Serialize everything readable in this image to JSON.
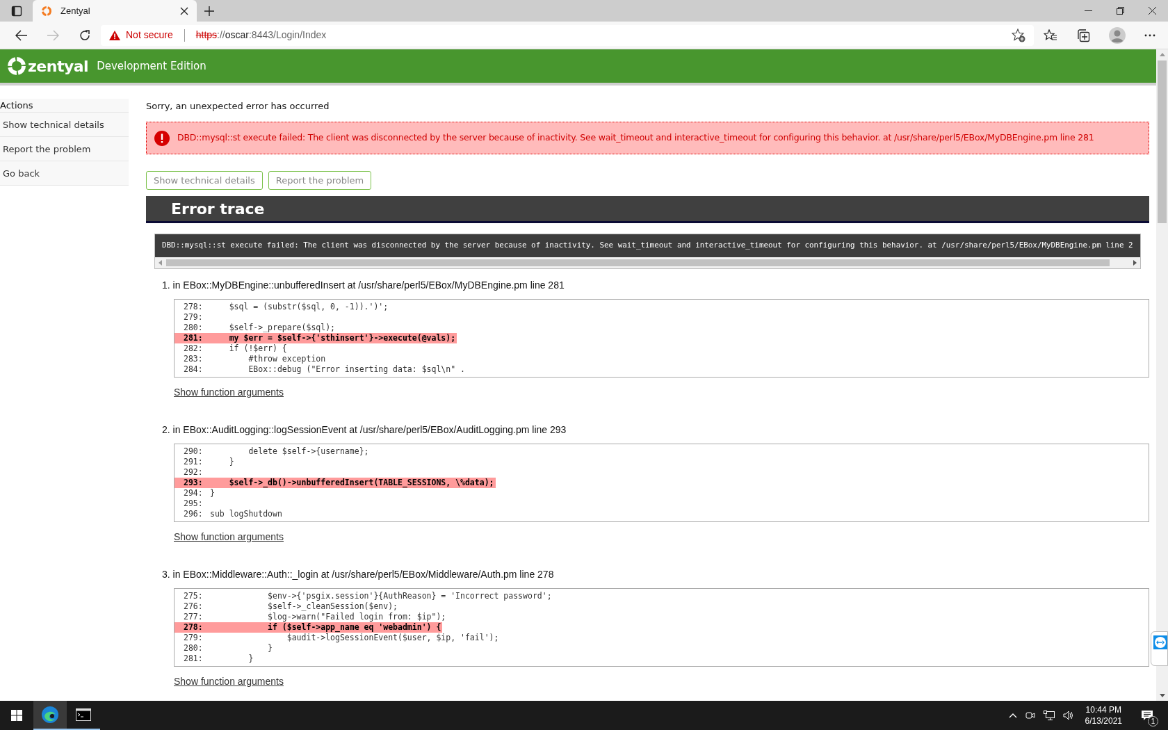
{
  "browser": {
    "tab_title": "Zentyal",
    "security_label": "Not secure",
    "url_scheme": "https",
    "url_sep": "://",
    "url_host": "oscar",
    "url_path": ":8443/Login/Index"
  },
  "header": {
    "logo_text": "zentyal",
    "edition": "Development Edition"
  },
  "sidebar": {
    "title": "Actions",
    "items": [
      "Show technical details",
      "Report the problem",
      "Go back"
    ]
  },
  "main": {
    "intro": "Sorry, an unexpected error has occurred",
    "error_message": "DBD::mysql::st execute failed: The client was disconnected by the server because of inactivity. See wait_timeout and interactive_timeout for configuring this behavior. at /usr/share/perl5/EBox/MyDBEngine.pm line 281",
    "buttons": [
      "Show technical details",
      "Report the problem"
    ],
    "trace_title": "Error trace",
    "trace_message": "DBD::mysql::st execute failed: The client was disconnected by the server because of inactivity. See wait_timeout and interactive_timeout for configuring this behavior. at /usr/share/perl5/EBox/MyDBEngine.pm line 2",
    "frames": [
      {
        "heading": "1. in EBox::MyDBEngine::unbufferedInsert at /usr/share/perl5/EBox/MyDBEngine.pm line 281",
        "link": "Show function arguments",
        "lines": [
          {
            "number": "278:",
            "code": "    $sql = (substr($sql, 0, -1)).')';",
            "highlighted": false
          },
          {
            "number": "279:",
            "highlighted": false
          },
          {
            "number": "280:",
            "code": "    $self->_prepare($sql);",
            "highlighted": false
          },
          {
            "number": "281:",
            "code": "    my $err = $self->{'sthinsert'}->execute(@vals);",
            "highlighted": true
          },
          {
            "number": "282:",
            "code": "    if (!$err) {",
            "highlighted": false
          },
          {
            "number": "283:",
            "code": "        #throw exception",
            "highlighted": false
          },
          {
            "number": "284:",
            "code": "        EBox::debug (\"Error inserting data: $sql\\n\" .",
            "highlighted": false
          }
        ]
      },
      {
        "heading": "2. in EBox::AuditLogging::logSessionEvent at /usr/share/perl5/EBox/AuditLogging.pm line 293",
        "link": "Show function arguments",
        "lines": [
          {
            "number": "290:",
            "code": "        delete $self->{username};",
            "highlighted": false
          },
          {
            "number": "291:",
            "code": "    }",
            "highlighted": false
          },
          {
            "number": "292:",
            "highlighted": false
          },
          {
            "number": "293:",
            "code": "    $self->_db()->unbufferedInsert(TABLE_SESSIONS, \\%data);",
            "highlighted": true
          },
          {
            "number": "294:",
            "code": "}",
            "highlighted": false
          },
          {
            "number": "295:",
            "highlighted": false
          },
          {
            "number": "296:",
            "code": "sub logShutdown",
            "highlighted": false
          }
        ]
      },
      {
        "heading": "3. in EBox::Middleware::Auth::_login at /usr/share/perl5/EBox/Middleware/Auth.pm line 278",
        "link": "Show function arguments",
        "lines": [
          {
            "number": "275:",
            "code": "            $env->{'psgix.session'}{AuthReason} = 'Incorrect password';",
            "highlighted": false
          },
          {
            "number": "276:",
            "code": "            $self->_cleanSession($env);",
            "highlighted": false
          },
          {
            "number": "277:",
            "code": "            $log->warn(\"Failed login from: $ip\");",
            "highlighted": false
          },
          {
            "number": "278:",
            "code": "            if ($self->app_name eq 'webadmin') {",
            "highlighted": true
          },
          {
            "number": "279:",
            "code": "                $audit->logSessionEvent($user, $ip, 'fail');",
            "highlighted": false
          },
          {
            "number": "280:",
            "code": "            }",
            "highlighted": false
          },
          {
            "number": "281:",
            "code": "        }",
            "highlighted": false
          }
        ]
      }
    ]
  },
  "taskbar": {
    "time": "10:44 PM",
    "date": "6/13/2021",
    "notification_count": "1"
  }
}
